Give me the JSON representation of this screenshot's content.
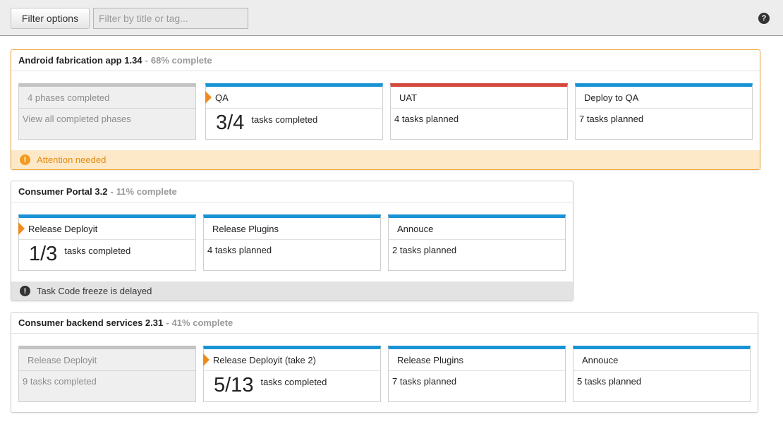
{
  "toolbar": {
    "filter_button": "Filter options",
    "filter_placeholder": "Filter by title or tag...",
    "help_icon": "?"
  },
  "releases": [
    {
      "title": "Android fabrication app 1.34",
      "separator": "-",
      "progress": "68% complete",
      "status": "attention",
      "phases": [
        {
          "name": "4 phases completed",
          "detail": "View all completed phases",
          "state": "completed"
        },
        {
          "name": "QA",
          "big": "3/4",
          "detail": "tasks completed",
          "state": "current"
        },
        {
          "name": "UAT",
          "detail": "4 tasks planned",
          "state": "planned",
          "color": "#d2483a"
        },
        {
          "name": "Deploy to QA",
          "detail": "7 tasks planned",
          "state": "planned"
        }
      ],
      "footer": {
        "icon": "!",
        "text": "Attention needed"
      }
    },
    {
      "title": "Consumer Portal 3.2",
      "separator": "-",
      "progress": "11% complete",
      "status": "info",
      "phases": [
        {
          "name": "Release Deployit",
          "big": "1/3",
          "detail": "tasks completed",
          "state": "current"
        },
        {
          "name": "Release Plugins",
          "detail": "4 tasks planned",
          "state": "planned"
        },
        {
          "name": "Annouce",
          "detail": "2 tasks planned",
          "state": "planned"
        }
      ],
      "footer": {
        "icon": "!",
        "text": "Task Code freeze is delayed"
      }
    },
    {
      "title": "Consumer backend services 2.31",
      "separator": "-",
      "progress": "41% complete",
      "status": "normal",
      "phases": [
        {
          "name": "Release Deployit",
          "detail": "9 tasks completed",
          "state": "completed"
        },
        {
          "name": "Release Deployit (take 2)",
          "big": "5/13",
          "detail": "tasks completed",
          "state": "current"
        },
        {
          "name": "Release Plugins",
          "detail": "7 tasks planned",
          "state": "planned"
        },
        {
          "name": "Annouce",
          "detail": "5 tasks planned",
          "state": "planned"
        }
      ]
    }
  ],
  "colors": {
    "accent_blue": "#1a93d5",
    "alert_red": "#d2483a",
    "warning_orange": "#f29b1f",
    "current_marker": "#f08a1c"
  }
}
